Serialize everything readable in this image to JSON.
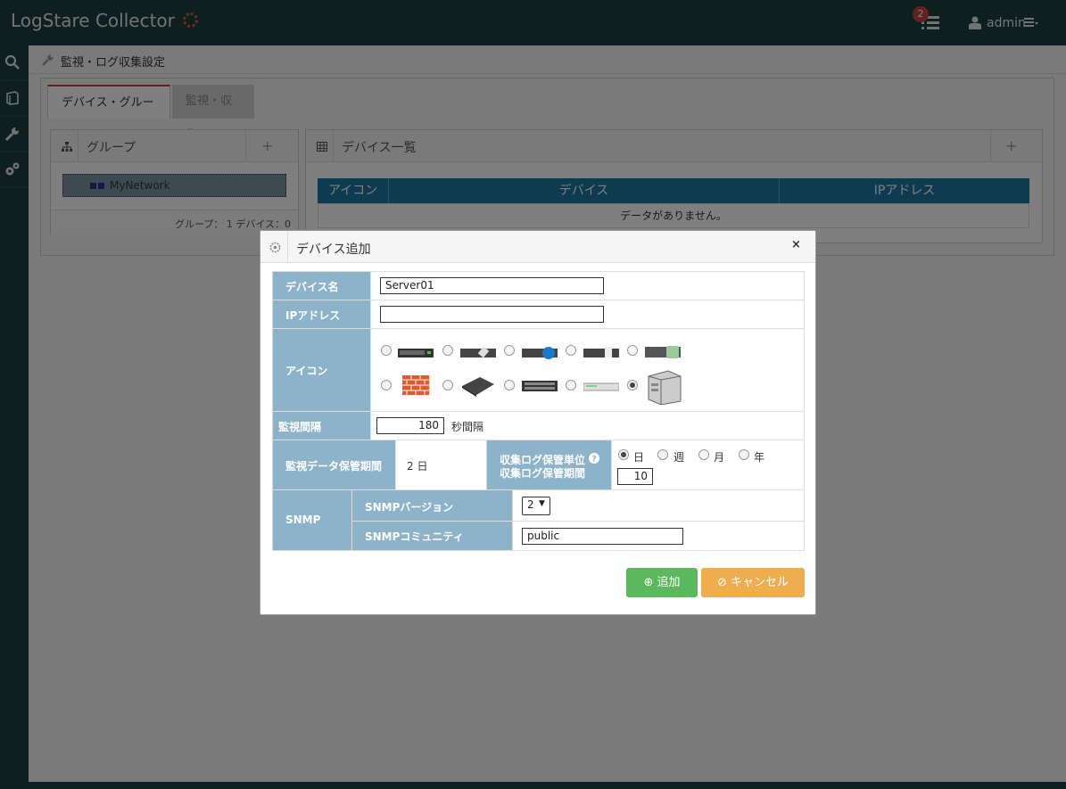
{
  "header": {
    "app_title": "LogStare Collector",
    "notification_count": "2",
    "user": "admin",
    "icons": [
      "spinner-icon",
      "list-icon",
      "user-icon",
      "menu-icon"
    ]
  },
  "sidebar": {
    "items": [
      {
        "name": "search",
        "icon": "search-icon"
      },
      {
        "name": "documents",
        "icon": "book-icon"
      },
      {
        "name": "settings",
        "icon": "wrench-icon"
      },
      {
        "name": "config",
        "icon": "gears-icon"
      }
    ]
  },
  "breadcrumb": {
    "label": "監視・ログ収集設定"
  },
  "tabs": [
    {
      "label": "デバイス・グループ",
      "active": true
    },
    {
      "label": "監視・収集",
      "active": false
    }
  ],
  "group_panel": {
    "title": "グループ",
    "item": "MyNetwork",
    "footer": "グループ： 1 デバイス：0"
  },
  "device_panel": {
    "title": "デバイス一覧",
    "columns": [
      "アイコン",
      "デバイス",
      "IPアドレス"
    ],
    "empty_text": "データがありません。"
  },
  "dialog": {
    "title": "デバイス追加",
    "close_label": "×",
    "device_name_label": "デバイス名",
    "device_name_value": "Server01",
    "ip_label": "IPアドレス",
    "ip_value": "",
    "icon_label": "アイコン",
    "icons": [
      "rack-server-1u",
      "router",
      "switch-blue",
      "rack-2u",
      "storage-server",
      "firewall",
      "appliance",
      "switch-24port",
      "hub",
      "tower-server"
    ],
    "selected_icon_index": 9,
    "interval_label": "監視間隔",
    "interval_value": "180",
    "interval_unit": "秒間隔",
    "retention_label": "監視データ保管期間",
    "retention_value": "2 日",
    "log_unit_label": "収集ログ保管単位",
    "log_period_label": "収集ログ保管期間",
    "units": [
      "日",
      "週",
      "月",
      "年"
    ],
    "selected_unit": "日",
    "log_period_value": "10",
    "snmp_label": "SNMP",
    "snmp_version_label": "SNMPバージョン",
    "snmp_version_value": "2",
    "snmp_community_label": "SNMPコミュニティ",
    "snmp_community_value": "public",
    "add_button": "追加",
    "cancel_button": "キャンセル"
  },
  "colors": {
    "topbar": "#1e3c3f",
    "accent_red": "#c9443d",
    "table_header": "#1a76a0",
    "form_label": "#8cb3c9",
    "add_button": "#5cb85c",
    "cancel_button": "#f0ad4e"
  }
}
